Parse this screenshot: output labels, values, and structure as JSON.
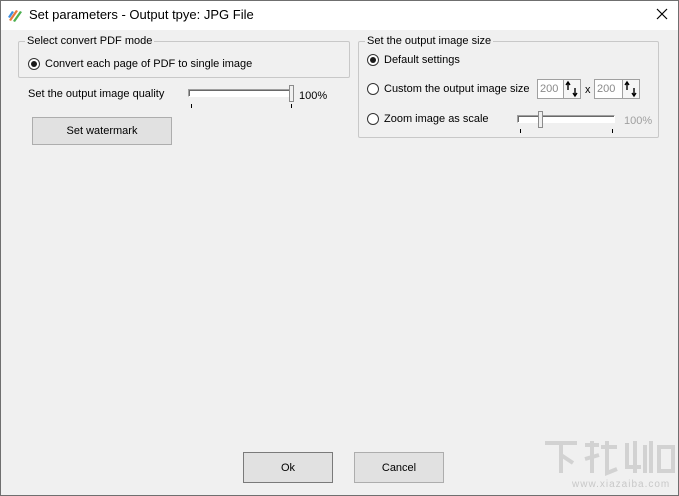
{
  "window": {
    "title": "Set parameters - Output tpye: JPG File",
    "icon": "pdf-converter-app-icon",
    "close_icon": "close-icon"
  },
  "convert_mode": {
    "legend": "Select convert PDF mode",
    "option_label": "Convert each page of PDF to single image",
    "option_checked": true
  },
  "quality": {
    "label": "Set the output image quality",
    "value_text": "100%",
    "value": 100
  },
  "watermark_button": {
    "label": "Set watermark"
  },
  "output_size": {
    "legend": "Set the output image size",
    "default_label": "Default settings",
    "default_checked": true,
    "custom_label": "Custom the output image size",
    "custom_checked": false,
    "width_value": "200",
    "height_value": "200",
    "separator": "x",
    "zoom_label": "Zoom image as scale",
    "zoom_checked": false,
    "zoom_value_text": "100%",
    "zoom_value": 100
  },
  "footer": {
    "ok_label": "Ok",
    "cancel_label": "Cancel"
  },
  "watermark_logo": {
    "text": "www.xiazaiba.com",
    "color": "#c8c8c8"
  }
}
